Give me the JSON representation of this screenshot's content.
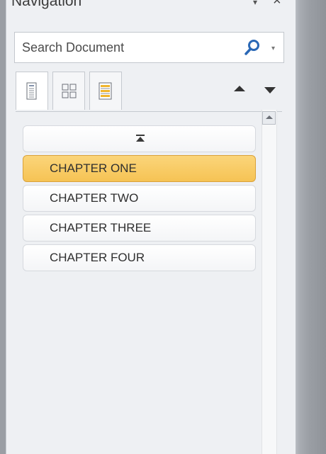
{
  "pane": {
    "title": "Navigation",
    "title_dropdown": "▾",
    "close": "×"
  },
  "search": {
    "placeholder": "Search Document",
    "dropdown": "▾"
  },
  "tabs": [
    {
      "name": "headings",
      "active": true
    },
    {
      "name": "pages",
      "active": false
    },
    {
      "name": "results",
      "active": false
    }
  ],
  "headings": [
    {
      "label": "CHAPTER ONE",
      "selected": true
    },
    {
      "label": "CHAPTER TWO",
      "selected": false
    },
    {
      "label": "CHAPTER THREE",
      "selected": false
    },
    {
      "label": "CHAPTER FOUR",
      "selected": false
    }
  ],
  "colors": {
    "selected": "#f6c354",
    "accent_icon": "#2a68b6"
  }
}
